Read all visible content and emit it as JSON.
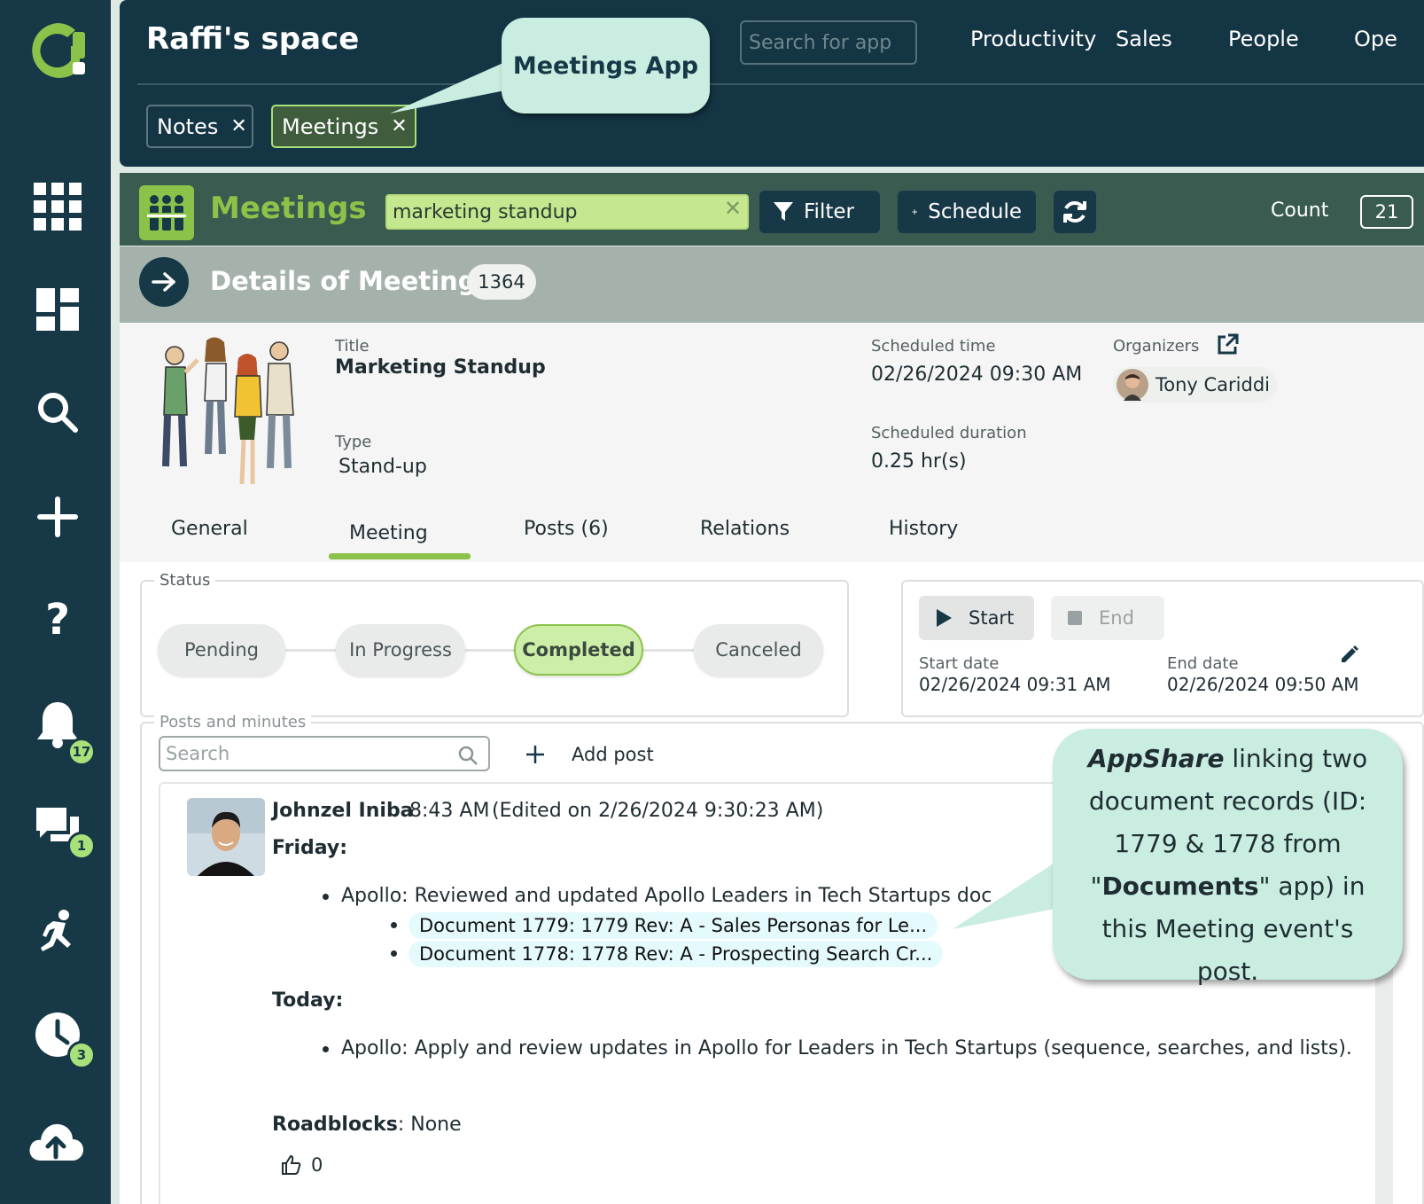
{
  "window": {
    "space_title": "Raffi's space"
  },
  "top_nav": {
    "search_placeholder": "Search for app",
    "items": [
      "Productivity",
      "Sales",
      "People",
      "Ope"
    ]
  },
  "open_tabs": [
    {
      "label": "Notes",
      "close": "✕",
      "active": false
    },
    {
      "label": "Meetings",
      "close": "✕",
      "active": true
    }
  ],
  "callouts": {
    "meetings_app": "Meetings App",
    "appshare": {
      "strong": "AppShare",
      "part1": " linking two document records (ID: 1779 & 1778 from \"",
      "strong2": "Documents",
      "part2": "\" app) in this Meeting event's post."
    }
  },
  "sidebar": {
    "badges": {
      "notifications": "17",
      "messages": "1",
      "timers": "3"
    },
    "icons": [
      "apps-grid-icon",
      "dashboard-icon",
      "search-icon",
      "add-icon",
      "help-icon",
      "bell-icon",
      "chat-icon",
      "activity-icon",
      "clock-icon",
      "cloud-upload-icon"
    ]
  },
  "toolbar": {
    "app_name": "Meetings",
    "search_value": "marketing standup",
    "clear": "✕",
    "filter_label": "Filter",
    "schedule_label": "Schedule",
    "count_label": "Count",
    "count_value": "21"
  },
  "details": {
    "title": "Details of Meetings",
    "total": "1364"
  },
  "record": {
    "title_label": "Title",
    "title_value": "Marketing Standup",
    "type_label": "Type",
    "type_value": "Stand-up",
    "scheduled_time_label": "Scheduled time",
    "scheduled_time_value": "02/26/2024 09:30 AM",
    "duration_label": "Scheduled duration",
    "duration_value": "0.25 hr(s)",
    "organizers_label": "Organizers",
    "organizer_name": "Tony Cariddi"
  },
  "tabs": [
    {
      "label": "General"
    },
    {
      "label": "Meeting",
      "active": true
    },
    {
      "label": "Posts (6)"
    },
    {
      "label": "Relations"
    },
    {
      "label": "History"
    }
  ],
  "status": {
    "legend": "Status",
    "steps": [
      "Pending",
      "In Progress",
      "Completed",
      "Canceled"
    ],
    "current": "Completed"
  },
  "timer": {
    "start_label": "Start",
    "end_label": "End",
    "start_date_label": "Start date",
    "start_date_value": "02/26/2024 09:31 AM",
    "end_date_label": "End date",
    "end_date_value": "02/26/2024 09:50 AM"
  },
  "posts": {
    "legend": "Posts and minutes",
    "search_placeholder": "Search",
    "add_post_label": "Add post",
    "post": {
      "author": "Johnzel Iniba",
      "time": "8:43 AM",
      "edited": "(Edited on 2/26/2024 9:30:23 AM)",
      "friday_heading": "Friday:",
      "friday_item": "Apollo: Reviewed and updated Apollo Leaders in Tech Startups doc",
      "doc_links": [
        "Document 1779: 1779 Rev: A - Sales Personas for Le...",
        "Document 1778: 1778 Rev: A - Prospecting Search Cr..."
      ],
      "today_heading": "Today:",
      "today_item": "Apollo: Apply and review updates in Apollo for Leaders in Tech Startups (sequence, searches, and lists).",
      "roadblocks_heading": "Roadblocks",
      "roadblocks_value": ": None",
      "likes": "0"
    }
  },
  "colors": {
    "brand_green": "#8bc34a",
    "navy": "#173847",
    "callout": "#c9ede0"
  }
}
